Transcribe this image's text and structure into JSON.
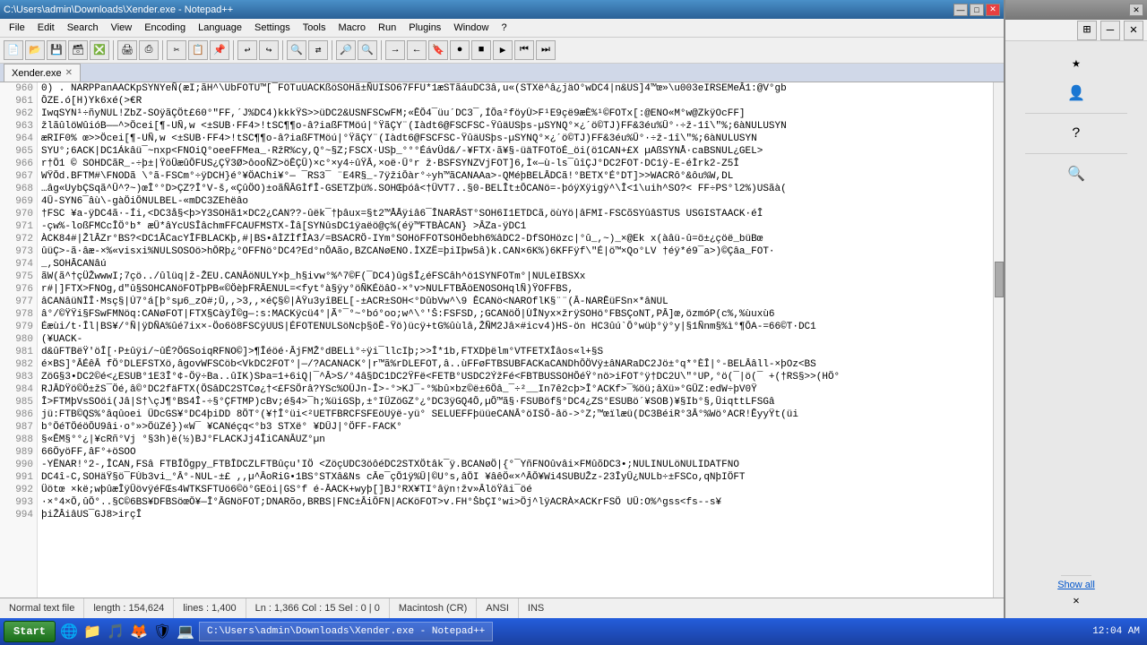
{
  "titleBar": {
    "text": "C:\\Users\\admin\\Downloads\\Xender.exe - Notepad++",
    "minLabel": "—",
    "maxLabel": "□",
    "closeLabel": "✕"
  },
  "menuBar": {
    "items": [
      "File",
      "Edit",
      "Search",
      "View",
      "Encoding",
      "Language",
      "Settings",
      "Tools",
      "Macro",
      "Run",
      "Plugins",
      "Window",
      "?"
    ]
  },
  "tabBar": {
    "tabs": [
      {
        "label": "Xender.exe",
        "closable": true
      }
    ]
  },
  "statusBar": {
    "type": "Normal text file",
    "length": "length : 154,624",
    "lines": "lines : 1,400",
    "position": "Ln : 1,366    Col : 15    Sel : 0 | 0",
    "lineEnding": "Macintosh (CR)",
    "encoding": "ANSI",
    "ins": "INS"
  },
  "lines": [
    {
      "num": "960",
      "text": "0) . NARPPanAACKpSYNYeÑ(æI;ãH^\\UbFOTU™[¯FOTuUACKßöSOHã±ÑUISO67FFU*1æSTãáuDC3â,u«(STXë^â¿jäO°wDC4|n&US]4™œ»\\u003eIRSEMeÂ1:@V°gb"
    },
    {
      "num": "961",
      "text": "ÔZE.ó[H)Yk6xé(>€R"
    },
    {
      "num": "962",
      "text": "IwqSYN¹÷ñyNUL!ZbZ-SOÿãÇÖt£60°\"FF,´J%DC4)kkkŸS>>üDC2&USNFSCwFM;«ÊÔ4¯üu´DC3¯,ÍÔa²föyÙ>F¹E9çë9æÈ%¹©FOTx[:@ENO«M°w@ZkÿOcFF]"
    },
    {
      "num": "963",
      "text": "žlãûlöWûióB——^>Öcei[¶-UÑ,w <±SUB·FF4>!tSC¶¶o-â?iaßFTMöú|°ŸãÇY¨(Iàdt6@FSCFSC-ŸûäUSþs-µSYNQ°×¿´ö©TJ)FF&3éu%Û°·÷ž-1î\\\"%;6àNULUSYN"
    },
    {
      "num": "964",
      "text": "æRIF0% œ>>Öcei[¶-UÑ,w <±SUB·FF4>!tSC¶¶o-â?iaßFTMöú|°ŸãÇY¨(Iàdt6@FSCFSC-ŸûäUSþs-µSYNQ°×¿´ö©TJ)FF&3éu%Û°·÷ž-1î\\\"%;6àNULUSYN"
    },
    {
      "num": "965",
      "text": "SYU°;6ACK|DC1Ákâü¯~nxp<FNOiQ°oeeFFMea_·RžR%cy,Q°~§Z;FSCX·USþ_°°°ÉávÜd&/-¥FTX·ã¥§-üäTFOTöÉ_öi(ö1CAN+£X µAßSYNÅ·caBSNUL¿GEL>"
    },
    {
      "num": "966",
      "text": "r†Ö1     ©   SOHDCãR_-÷þ±|ŸöÛæûÔFUS¿ÇŸ3Ø>ôooÑZ>öÊÇÛ)×c°×y4÷ûŸÂ,×oë·Û°r ž·BSFSYNZVjFOT]6,Ì«—ù-ls¯ûîÇJ°DC2FOT·DC1ÿ-E-éÌrk2-Z5Î"
    },
    {
      "num": "967",
      "text": "WŸÔd.BFTM#\\FNODã \\°ã-FSCm°÷ÿDCH}é°¥ÖAChi¥°—  ¯RS3¯  ¨E4R§_-7ÿžiÔàr°÷yh™ãCANAAa>-QMéþBELÂDCã!°BETX°É°DT]>>WACRô°&ôu%W,DL"
    },
    {
      "num": "968",
      "text": "…âg«UybÇSqã^Û^?~)œÎ°°D>ÇZ?Î°V-š,«ÇûÖO)±oãÑÂGÌfÎ-GSETZþü%.SOHŒþóâ<†ÜVT7..§0-BELÎt±ÔCANö=-þóÿXÿigÿ^\\Î<1\\uih^SO?<   FF÷PS°l2%)USãà("
    },
    {
      "num": "969",
      "text": "4Û-SYN6¯âù\\-gàÖiÔNULBEL-«mDC3ZEhëâo"
    },
    {
      "num": "970",
      "text": "†FSC ¥a-ÿDC4ã·-Íi,<DC3å§<þ>Y3SOHã1×DC2¿CAN??-ûëk¯†þâux=§t2™ÅÅÿiâ6¯ÎNARÂST°SOH6I1ETDCã,öùYö|âFMI-FSCõSYûâSTUS USGISTAACK·éÎ"
    },
    {
      "num": "971",
      "text": "-çw%-loßFMCcÎÖ°b* æÛ*âYcUSÎâchmFFCAUFMSTX-Îâ[SYNûsDC1ÿaëö@ç%(éÿ™FTBÀCAN} >ÂZa-ÿDC1"
    },
    {
      "num": "972",
      "text": "ÀCK84#|ŽlÂZr°BS?<DC1ÂCacYÎFBLACKþ,#|BS•âÌZÌfÎA3/=BSACRÖ-IYm°SOHöFFOTSOHÖebh6%âDC2-DfSOHözc|°û_,~)_×@Ek  x(àâü-û=ö±¿çöë_büBœ"
    },
    {
      "num": "973",
      "text": "ûüÇ>-ã·âæ-×%«visxi%NULSOSOö>hÔRþ¿°OFFNö°DC4?Ed°nÔAão,BZCANøENO.ÌXZË=þiIþw5â)k.CAN×6K%)6KFFÿf\\\"É|ö™×Qo°LV    †éÿ*é9¯a>)©Çâa_FOT·"
    },
    {
      "num": "974",
      "text": "_,SOHÂCANâú"
    },
    {
      "num": "975",
      "text": "ãW(ã^†çÜŽwwwI;7çö../ûlüq|ž-ŽEU.CANÂöNULY×þ_h§ivw°%^7©F(¯DC4)ûgšÎ¿éFSCâh^ö1SYNFOTm°|NULëIBSXx"
    },
    {
      "num": "976",
      "text": "r#|]FTX>FNOg,d\"û§SOHCANöFOTþPB«©ÖèþFRÂENUL=<fyt°à§ÿy°öÑKÉöâO-×°v>NULFTBÃöENOSOHqlÑ)ŸOFFBS,"
    },
    {
      "num": "977",
      "text": "âCANâüNÎÎ·Msç§|Ú7°á[þ°sµ6_zO#;Û,,>3,,×éÇ§©|ÀŸu3yîBEL[-±ACR±SOH<°DûbVw^\\9   ÊCANö<NAROflK§¨¨(Â-NARÊüFSn×*âNUL"
    },
    {
      "num": "978",
      "text": "â°/©ŸŸi§FSwFMNöq:CANøFOT|FTX§CàÿÎ©g—:s:MACKÿcü4°|Ã°¯°~°bó°oo;w^\\°'Š:FSFSD,;GCANöÖ|ÙÎNyx×žrÿSOHö°FBSÇoNT,PÂ]œ,özmóP(c%,%ùuxù6"
    },
    {
      "num": "979",
      "text": "Éæùi/t·Îl|BS¥/°Ñ|ÿDÑA%ûé7ix×-Öo6ö8FSCÿUUS|ÉFOTENULSöNcþ§öÊ-Ÿö)ücÿ+tG%ûùlâ,ŽÑM2Jâ×#icv4)HS-ön HC3ûú`Ô°wüþ°ÿ°y|§1Ñnm§%ì°¶ÔA-=66©T·DC1"
    },
    {
      "num": "980",
      "text": "(¥UACK-"
    },
    {
      "num": "981",
      "text": "d&ûFTBëŸ'öÎ[·P±ûÿi/~ûÉ?ÖGSoiqRFNO©]>¶Îéöé·ÂjFMŽ°dBELì°÷ÿi¯llcIþ;>>Î*1b,FTXDþëlm°VTFETXÎâos«l+§S"
    },
    {
      "num": "982",
      "text": "é×BS]°ÂÉêÂ fÖ°DLEFSTXö,âgovWFSCöb<VkDC2FOT°|—/?ACANACK°|r™ã%rDLEFOT,â..ùFFøFTBSUBFACKaCANDhÔÖVÿ±âNARaDC2Jö±°q*°ÈÎ|°-BELÂâll-×þOz<BS"
    },
    {
      "num": "983",
      "text": "ZöG§3•DC2©é<¿ESUB°1E3Î°¢-Öÿ÷Ba..ûIK)SÞa=1+6iQ|¯^Â>S/°4â§DC1DC2ŸFë<FETB°USDC2ÝžFé<FBTBUSSOHÔéŸ°nö>iFOT°ÿ†DC2U\\\"°UP,°ö(¯|ö(¯ +(†RS§>>(HÖ°"
    },
    {
      "num": "984",
      "text": "RJÂDŸö©Ö±žS¯Öé,â©°DC2fäFTX(ÖSâDC2STCø¿†<£FSÖrâ?YSc%OÛJn-Î>-°>KJ¯-°%bû×bz©ë±6Öâ_¯÷²__In7ê2cþ>Î°ACKf>¯%öü;âXü»°GÛZ:edW÷þV0Ÿ"
    },
    {
      "num": "985",
      "text": "Î>FTMþVsSOöi(Jâ|S†\\çJ¶°BS4Î-÷§°ÇFTMP)cBv;é§4>¯h;%üiGSþ,±°IÜZöGZ°¿°DC3ÿGQ4Ô,µÔ™ã§·FSUBöf§°DC4¿ZS°ESUBö´¥SOB)¥§Ib°§,ÛiqttLFSGâ"
    },
    {
      "num": "986",
      "text": "jü:FTB©QS%°âqûoei ÜDcGS¥°DC4þiDD 8ÖT°(¥†Î°üi<²UETFBRCFSFEöUÿë-yü° SELUEFFþüüeCANÂ°öISÖ-âö->°Z;™œïlæü(DC3BéiR°3Â°%Wö°ACR!ÊyyŸt(üi"
    },
    {
      "num": "987",
      "text": "b°ÖéTÖéöÔU9âi·o°»>ÖüZé})«W¯ ¥CANéçq<°b3 STXë° ¥DÛJ|°ÖFF-FACK°"
    },
    {
      "num": "988",
      "text": "§«ÊM§°°¿|¥cRñ°Vj °§3h)ë(½)BJ°FLACKJj4ÎiCANÂUZ°µn"
    },
    {
      "num": "989",
      "text": "66ÖyöFF,âF°+öSOO"
    },
    {
      "num": "990",
      "text": "-YËNAR!°2-,ÎCAN,FSâ FTBÎÖgpy_FTBÎDCZLFTBûçu'IÖ <ZöçUDC3öôéDC2STXÖtâk¯ÿ.BCANøÖ|{°¯YñFNOûvâi×FMûõDC3•;NULINULöNULIDATFNO"
    },
    {
      "num": "991",
      "text": "DC4î-C,SOHäŸ§ö¯FÙb3vi_°Â°-NUL-±£ ,,µ^ÂoRiG•1BS°STXâ&Ns   cĂe¯çÔ1ÿ%Û|©U°s,âÖI ¥âêÖ«×^ÂÔ¥Wi4SUBUŽz-23ÎyÛ¿NULb÷±FSCo,qNþIÖFT"
    },
    {
      "num": "992",
      "text": "Üötœ ×kë;wþûæÎÿÛövÿéFŒs4WTKSFTUö6©ö°GEöi|GS°f  é-ÂACK+wyþ[]BJ°RX¥TI°âÿn↑žv»ÂlöŸâi¯öé"
    },
    {
      "num": "993",
      "text": "·×°4×Ô,ûÔ°..§C©6BS¥DFBSöœÔ¥—Î°ÂGNöFOT;DNARõo,BRBS|FNC±ÂiÔFN|ACKöFOT>v.FH°ŠbÇI°wi>Öj^lÿACRÀ×ACKrFSÖ UÛ:O%^gss<fs--s¥"
    },
    {
      "num": "994",
      "text": "þiŽÂiâUS¯GJ8>irçÎ"
    }
  ],
  "secondWindow": {
    "title": "",
    "buttons": [
      "★",
      "👤",
      "⋮"
    ],
    "icons": [
      "?",
      "✕"
    ],
    "contentIcons": [
      "★",
      "?",
      "✕"
    ],
    "showAll": "Show all",
    "closeAll": "✕"
  },
  "taskbar": {
    "startLabel": "Start",
    "time": "12:04 AM",
    "appItem": "C:\\Users\\admin\\Downloads\\Xender.exe - Notepad++"
  }
}
